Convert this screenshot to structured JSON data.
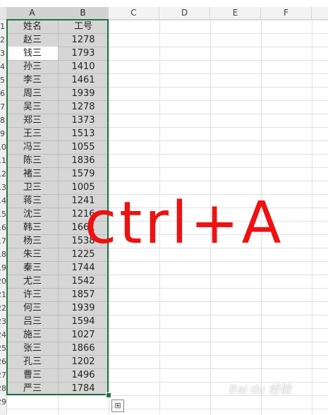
{
  "columns": [
    "A",
    "B",
    "C",
    "D",
    "E",
    "F"
  ],
  "row_numbers": [
    "1",
    "2",
    "3",
    "4",
    "5",
    "6",
    "7",
    "8",
    "9",
    "10",
    "11",
    "12",
    "13",
    "14",
    "15",
    "16",
    "17",
    "18",
    "19",
    "20",
    "21",
    "22",
    "23",
    "24",
    "25",
    "26",
    "27",
    "28",
    "29"
  ],
  "header_row": {
    "name": "姓名",
    "id": "工号"
  },
  "rows": [
    {
      "name": "赵三",
      "id": "1278"
    },
    {
      "name": "钱三",
      "id": "1793"
    },
    {
      "name": "孙三",
      "id": "1410"
    },
    {
      "name": "李三",
      "id": "1461"
    },
    {
      "name": "周三",
      "id": "1939"
    },
    {
      "name": "吴三",
      "id": "1278"
    },
    {
      "name": "郑三",
      "id": "1373"
    },
    {
      "name": "王三",
      "id": "1513"
    },
    {
      "name": "冯三",
      "id": "1055"
    },
    {
      "name": "陈三",
      "id": "1836"
    },
    {
      "name": "褚三",
      "id": "1579"
    },
    {
      "name": "卫三",
      "id": "1005"
    },
    {
      "name": "蒋三",
      "id": "1241"
    },
    {
      "name": "沈三",
      "id": "1216"
    },
    {
      "name": "韩三",
      "id": "1661"
    },
    {
      "name": "杨三",
      "id": "1538"
    },
    {
      "name": "朱三",
      "id": "1225"
    },
    {
      "name": "秦三",
      "id": "1744"
    },
    {
      "name": "尤三",
      "id": "1542"
    },
    {
      "name": "许三",
      "id": "1857"
    },
    {
      "name": "何三",
      "id": "1939"
    },
    {
      "name": "吕三",
      "id": "1594"
    },
    {
      "name": "施三",
      "id": "1027"
    },
    {
      "name": "张三",
      "id": "1866"
    },
    {
      "name": "孔三",
      "id": "1202"
    },
    {
      "name": "曹三",
      "id": "1496"
    },
    {
      "name": "严三",
      "id": "1784"
    }
  ],
  "overlay_text": "ctrl+A",
  "watermark_text": "Bai du 经验",
  "colors": {
    "selection_border": "#217346",
    "overlay": "#ee1111",
    "selection_fill": "#d6d6d6"
  },
  "icons": {
    "quick_analysis": "quick-analysis-icon"
  }
}
